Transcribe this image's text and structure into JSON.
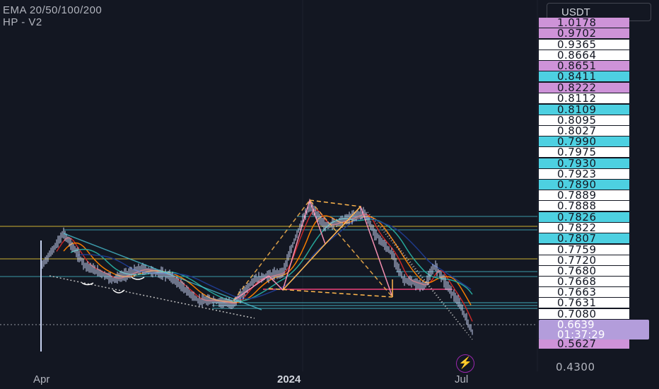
{
  "legend": {
    "line1": "EMA 20/50/100/200",
    "line2": "HP - V2"
  },
  "currency_button": "USDT",
  "price_labels": [
    {
      "text": "1.0178",
      "kind": "violet"
    },
    {
      "text": "0.9702",
      "kind": "violet"
    },
    {
      "text": "0.9365",
      "kind": "white"
    },
    {
      "text": "0.8664",
      "kind": "white"
    },
    {
      "text": "0.8651",
      "kind": "violet"
    },
    {
      "text": "0.8411",
      "kind": "cyan"
    },
    {
      "text": "0.8222",
      "kind": "violet"
    },
    {
      "text": "0.8112",
      "kind": "white"
    },
    {
      "text": "0.8109",
      "kind": "cyan"
    },
    {
      "text": "0.8095",
      "kind": "white"
    },
    {
      "text": "0.8027",
      "kind": "white"
    },
    {
      "text": "0.7990",
      "kind": "cyan"
    },
    {
      "text": "0.7975",
      "kind": "white"
    },
    {
      "text": "0.7930",
      "kind": "cyan"
    },
    {
      "text": "0.7923",
      "kind": "white"
    },
    {
      "text": "0.7890",
      "kind": "cyan"
    },
    {
      "text": "0.7889",
      "kind": "white"
    },
    {
      "text": "0.7888",
      "kind": "white"
    },
    {
      "text": "0.7826",
      "kind": "cyan"
    },
    {
      "text": "0.7822",
      "kind": "white"
    },
    {
      "text": "0.7807",
      "kind": "cyan"
    },
    {
      "text": "0.7759",
      "kind": "white"
    },
    {
      "text": "0.7720",
      "kind": "white"
    },
    {
      "text": "0.7680",
      "kind": "white"
    },
    {
      "text": "0.7668",
      "kind": "white"
    },
    {
      "text": "0.7663",
      "kind": "white"
    },
    {
      "text": "0.7631",
      "kind": "white"
    },
    {
      "text": "0.7080",
      "kind": "white"
    },
    {
      "text": "0.6639",
      "kind": "violet"
    },
    {
      "text": "0.5627",
      "kind": "violet"
    }
  ],
  "countdown": "01:37:29",
  "axis_price": "0.4300",
  "time_axis": [
    {
      "text": "Apr",
      "bold": false
    },
    {
      "text": "2024",
      "bold": true
    },
    {
      "text": "Jul",
      "bold": false
    }
  ],
  "colors": {
    "background": "#131722",
    "violet": "#ce93d8",
    "cyan": "#4dd0e1",
    "white": "#ffffff",
    "candle": "#c7d2f0",
    "ema_red": "#c62828",
    "ema_orange": "#f57c00",
    "ema_teal": "#26a69a",
    "ema_blue": "#1e3a8a",
    "pattern_pink": "#f48fb1",
    "pattern_orange": "#ffb74d",
    "level_yellow": "#fdd835",
    "level_cyan": "#4dd0e1",
    "level_red": "#ec407a"
  },
  "chart_data": {
    "type": "candlestick",
    "xlabel": "",
    "ylabel": "",
    "x_ticks": [
      "Apr",
      "2024",
      "Jul"
    ],
    "last_price": 0.6639,
    "ylim": [
      0.43,
      1.02
    ],
    "indicators": [
      "EMA 20",
      "EMA 50",
      "EMA 100",
      "EMA 200",
      "HP - V2"
    ],
    "price_levels": [
      1.0178,
      0.9702,
      0.9365,
      0.8664,
      0.8651,
      0.8411,
      0.8222,
      0.8112,
      0.8109,
      0.8095,
      0.8027,
      0.799,
      0.7975,
      0.793,
      0.7923,
      0.789,
      0.7889,
      0.7888,
      0.7826,
      0.7822,
      0.7807,
      0.7759,
      0.772,
      0.768,
      0.7668,
      0.7663,
      0.7631,
      0.708,
      0.6639,
      0.5627
    ]
  },
  "flash_icon": "lightning-icon"
}
